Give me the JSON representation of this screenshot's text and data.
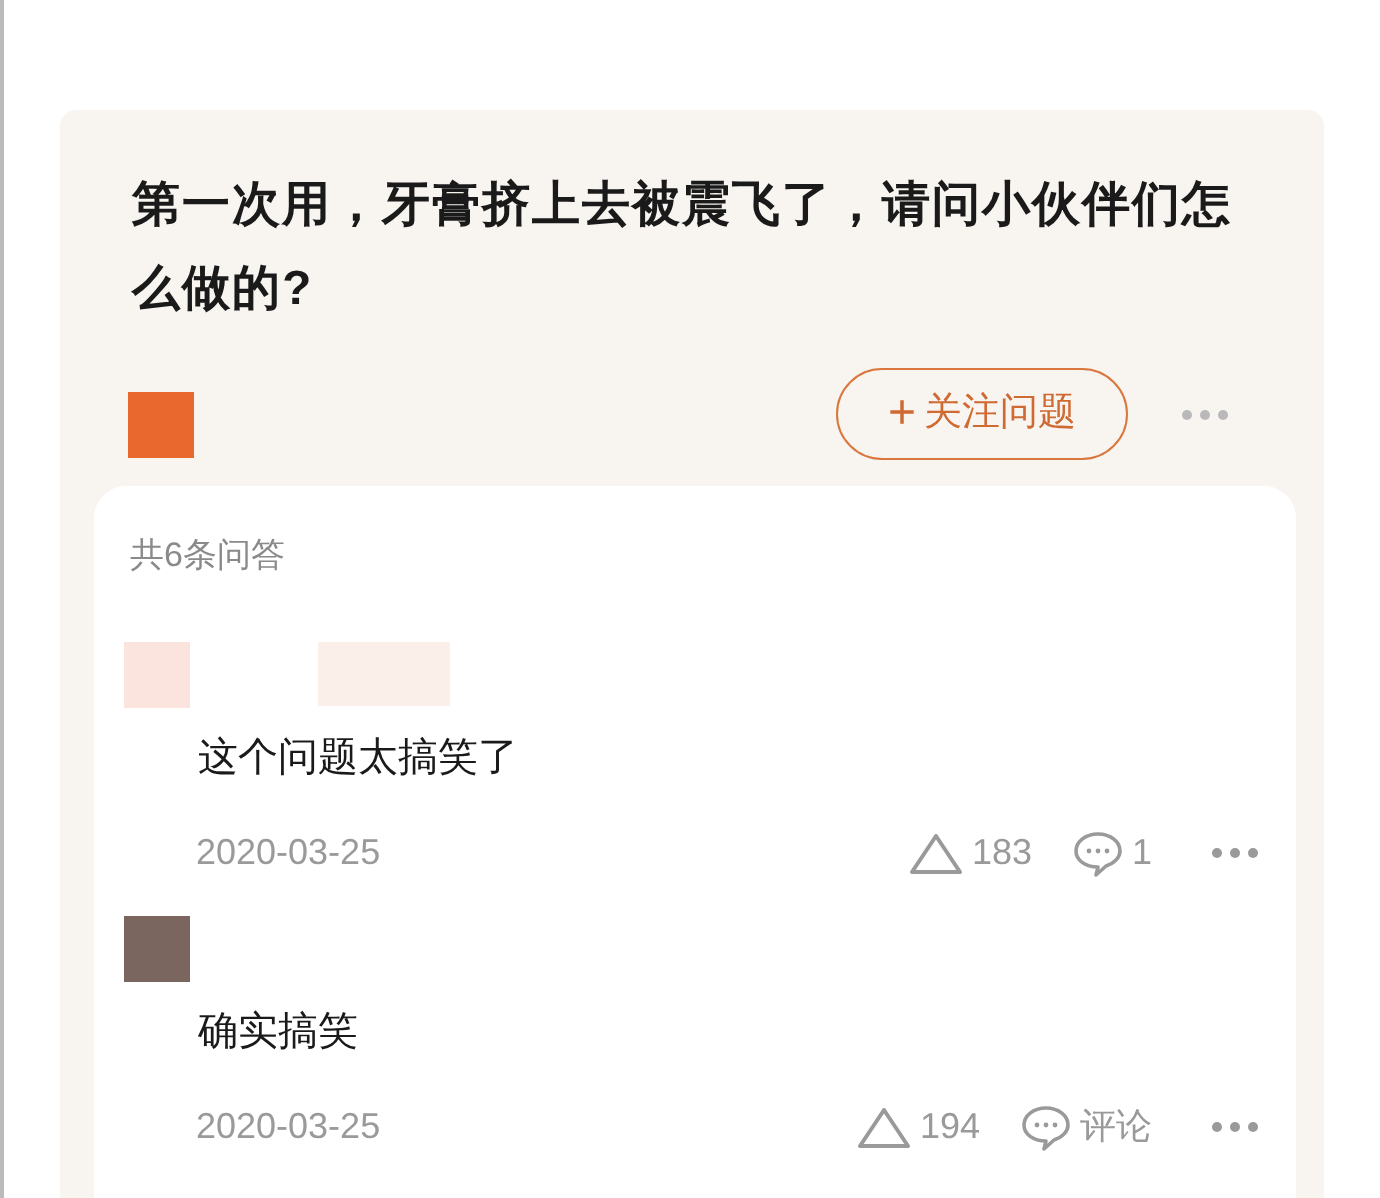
{
  "question": {
    "title": "第一次用，牙膏挤上去被震飞了，请问小伙伴们怎么做的?",
    "asker_avatar": {
      "color": "#e8682e"
    },
    "follow_button": {
      "icon": "+",
      "label": "关注问题"
    }
  },
  "answers_panel": {
    "count_label": "共6条问答",
    "answers": [
      {
        "avatar": {
          "color": "#fbe3de"
        },
        "text": "这个问题太搞笑了",
        "date": "2020-03-25",
        "likes": "183",
        "comments": "1"
      },
      {
        "avatar": {
          "color": "#7a665f"
        },
        "text": "确实搞笑",
        "date": "2020-03-25",
        "likes": "194",
        "comments": "评论"
      }
    ]
  }
}
